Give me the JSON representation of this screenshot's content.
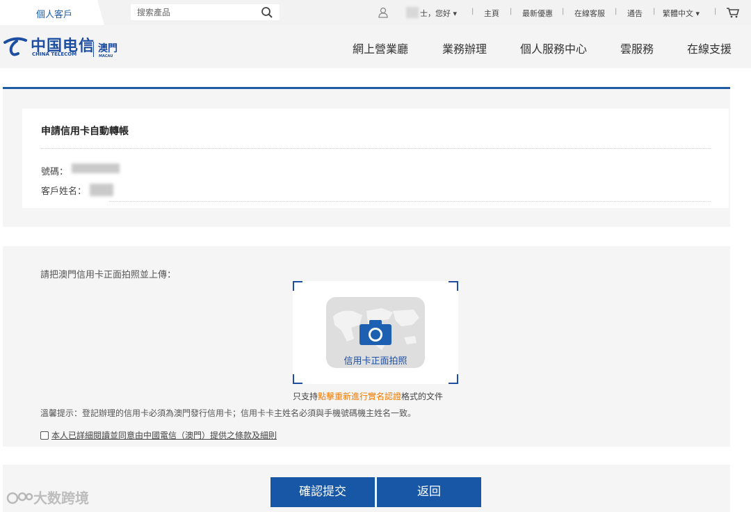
{
  "topbar": {
    "tab_personal": "個人客戶",
    "search_placeholder": "搜索產品",
    "greeting": "士，您好",
    "links": [
      "主頁",
      "最新優惠",
      "在線客服",
      "通告"
    ],
    "language": "繁體中文"
  },
  "header": {
    "logo_cn": "中国电信",
    "logo_en": "CHINA TELECOM",
    "logo_region": "澳門",
    "logo_region_en": "MACAU",
    "nav": [
      "網上營業廳",
      "業務辦理",
      "個人服務中心",
      "雲服務",
      "在線支援"
    ]
  },
  "form": {
    "title": "申請信用卡自動轉帳",
    "number_label": "號碼：",
    "name_label": "客戶姓名："
  },
  "upload": {
    "label": "請把澳門信用卡正面拍照並上傳：",
    "photo_caption": "信用卡正面拍照",
    "support_prefix": "只支持",
    "support_link": "點擊重新進行實名認證",
    "support_suffix": "格式的文件",
    "tip": "溫馨提示：登記辦理的信用卡必須為澳門發行信用卡；信用卡卡主姓名必須與手機號碼機主姓名一致。",
    "agree_text": "本人已詳細閱讀並同意由中國電信（澳門）提供之條款及細則"
  },
  "buttons": {
    "confirm": "確認提交",
    "back": "返回"
  },
  "watermark": "大数跨境",
  "colors": {
    "brand_blue": "#1757a6",
    "link_orange": "#f07a00"
  }
}
